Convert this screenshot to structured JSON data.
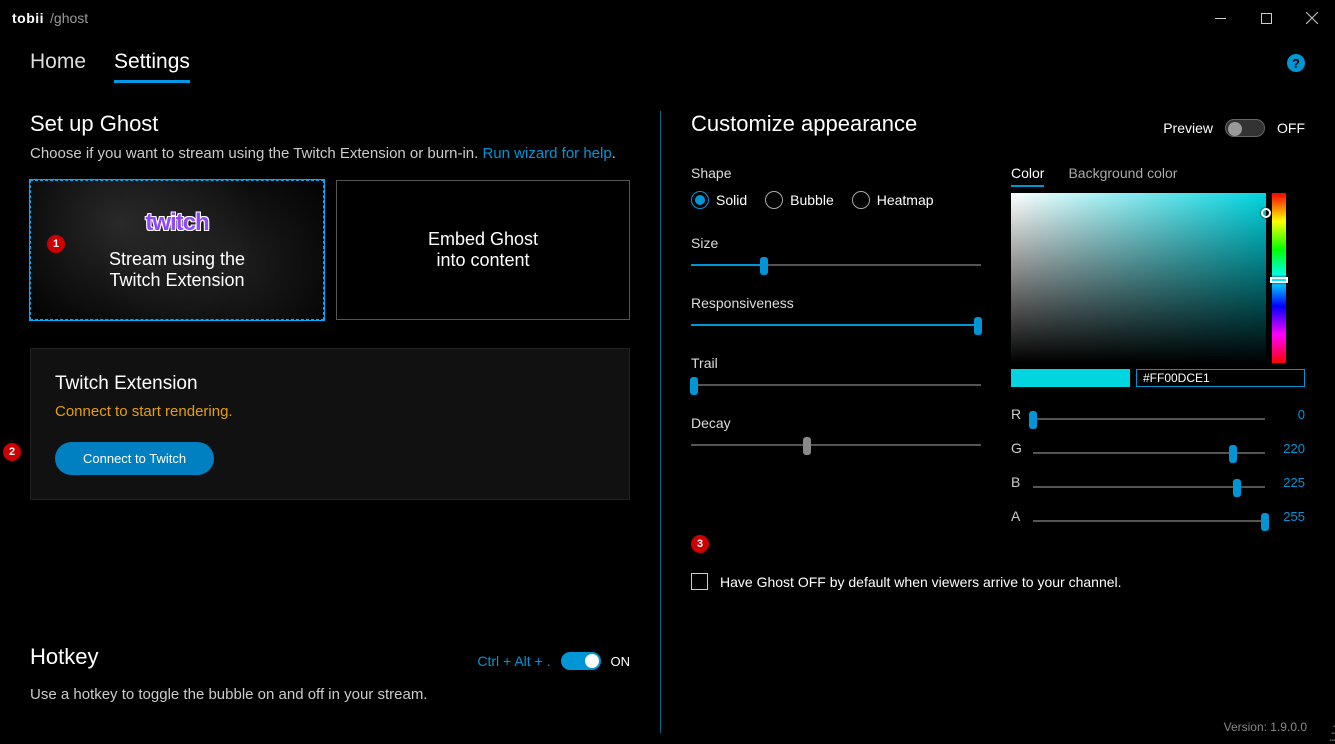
{
  "titlebar": {
    "brand": "tobii",
    "app": "/ghost"
  },
  "tabs": {
    "home": "Home",
    "settings": "Settings"
  },
  "help": "?",
  "setup": {
    "heading": "Set up Ghost",
    "sub_pre": "Choose if you want to stream using the Twitch Extension or burn-in. ",
    "wizard_link": "Run wizard for help",
    "sub_post": ".",
    "card1_logo": "twitch",
    "card1_line1": "Stream using the",
    "card1_line2": "Twitch Extension",
    "card2_line1": "Embed Ghost",
    "card2_line2": "into content"
  },
  "ext": {
    "title": "Twitch Extension",
    "msg": "Connect to start rendering.",
    "btn": "Connect to Twitch"
  },
  "hotkey": {
    "title": "Hotkey",
    "combo": "Ctrl + Alt + .",
    "state": "ON",
    "desc": "Use a hotkey to toggle the bubble on and off in your stream."
  },
  "appearance": {
    "heading": "Customize appearance",
    "preview_label": "Preview",
    "preview_state": "OFF",
    "shape_label": "Shape",
    "radios": {
      "solid": "Solid",
      "bubble": "Bubble",
      "heatmap": "Heatmap"
    },
    "size": "Size",
    "responsiveness": "Responsiveness",
    "trail": "Trail",
    "decay": "Decay",
    "color_tab": "Color",
    "bg_tab": "Background color",
    "hex": "#FF00DCE1",
    "r": {
      "label": "R",
      "val": "0"
    },
    "g": {
      "label": "G",
      "val": "220"
    },
    "b": {
      "label": "B",
      "val": "225"
    },
    "a": {
      "label": "A",
      "val": "255"
    },
    "default_off": "Have Ghost OFF by default when viewers arrive to your channel."
  },
  "annotations": {
    "a1": "1",
    "a2": "2",
    "a3": "3"
  },
  "version": "Version: 1.9.0.0",
  "sliders": {
    "size_pct": 25,
    "responsiveness_pct": 99,
    "trail_pct": 1,
    "decay_pct": 40,
    "r_pct": 0,
    "g_pct": 86,
    "b_pct": 88,
    "a_pct": 100
  }
}
